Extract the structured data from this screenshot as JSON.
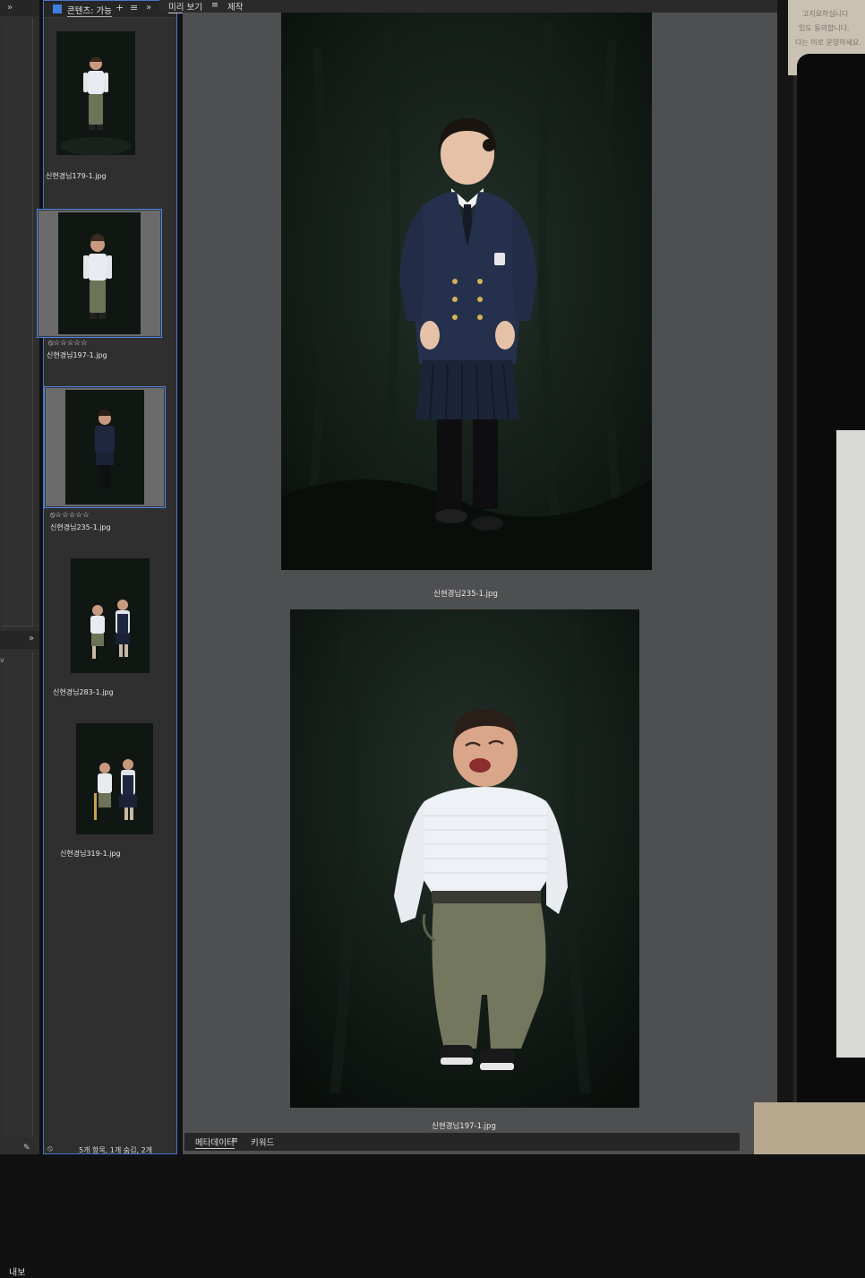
{
  "content_panel": {
    "title": "콘텐츠: 가능",
    "add_symbol": "+",
    "menu_symbol": "≡",
    "expand_symbol": "»",
    "items": [
      {
        "filename": "신현경님179-1.jpg",
        "rating": "",
        "selected": false
      },
      {
        "filename": "신현경님197-1.jpg",
        "rating": "⦸☆☆☆☆☆",
        "selected": true
      },
      {
        "filename": "신현경님235-1.jpg",
        "rating": "⦸☆☆☆☆☆",
        "selected": true
      },
      {
        "filename": "신현경님283-1.jpg",
        "rating": "",
        "selected": false
      },
      {
        "filename": "신현경님319-1.jpg",
        "rating": "",
        "selected": false
      }
    ],
    "status": "5개 항목, 1개 숨김, 2개"
  },
  "left_dock": {
    "expand_symbol": "»",
    "inner_label": "내보",
    "inner_expand": "»",
    "tiny_text": "v"
  },
  "preview": {
    "tabs": [
      {
        "label": "미리 보기",
        "active": true
      },
      {
        "label": "제작",
        "active": false
      }
    ],
    "menu_symbol": "≡",
    "images": [
      {
        "caption": "신현경님235-1.jpg"
      },
      {
        "caption": "신현경님197-1.jpg"
      }
    ]
  },
  "bottom_panel": {
    "tabs": [
      {
        "label": "메타데이터",
        "active": true
      },
      {
        "label": "키워드",
        "active": false
      }
    ],
    "menu_symbol": "≡"
  },
  "background_paper": {
    "lines": [
      "고지요하십니다",
      "있도 동의합니다.",
      "다는 이로 운영하세요."
    ]
  },
  "colors": {
    "panel_bg": "#2f2f2f",
    "preview_bg": "#4e4f51",
    "selection_blue": "#4a86e8",
    "photo_backdrop": "#0e1411"
  }
}
